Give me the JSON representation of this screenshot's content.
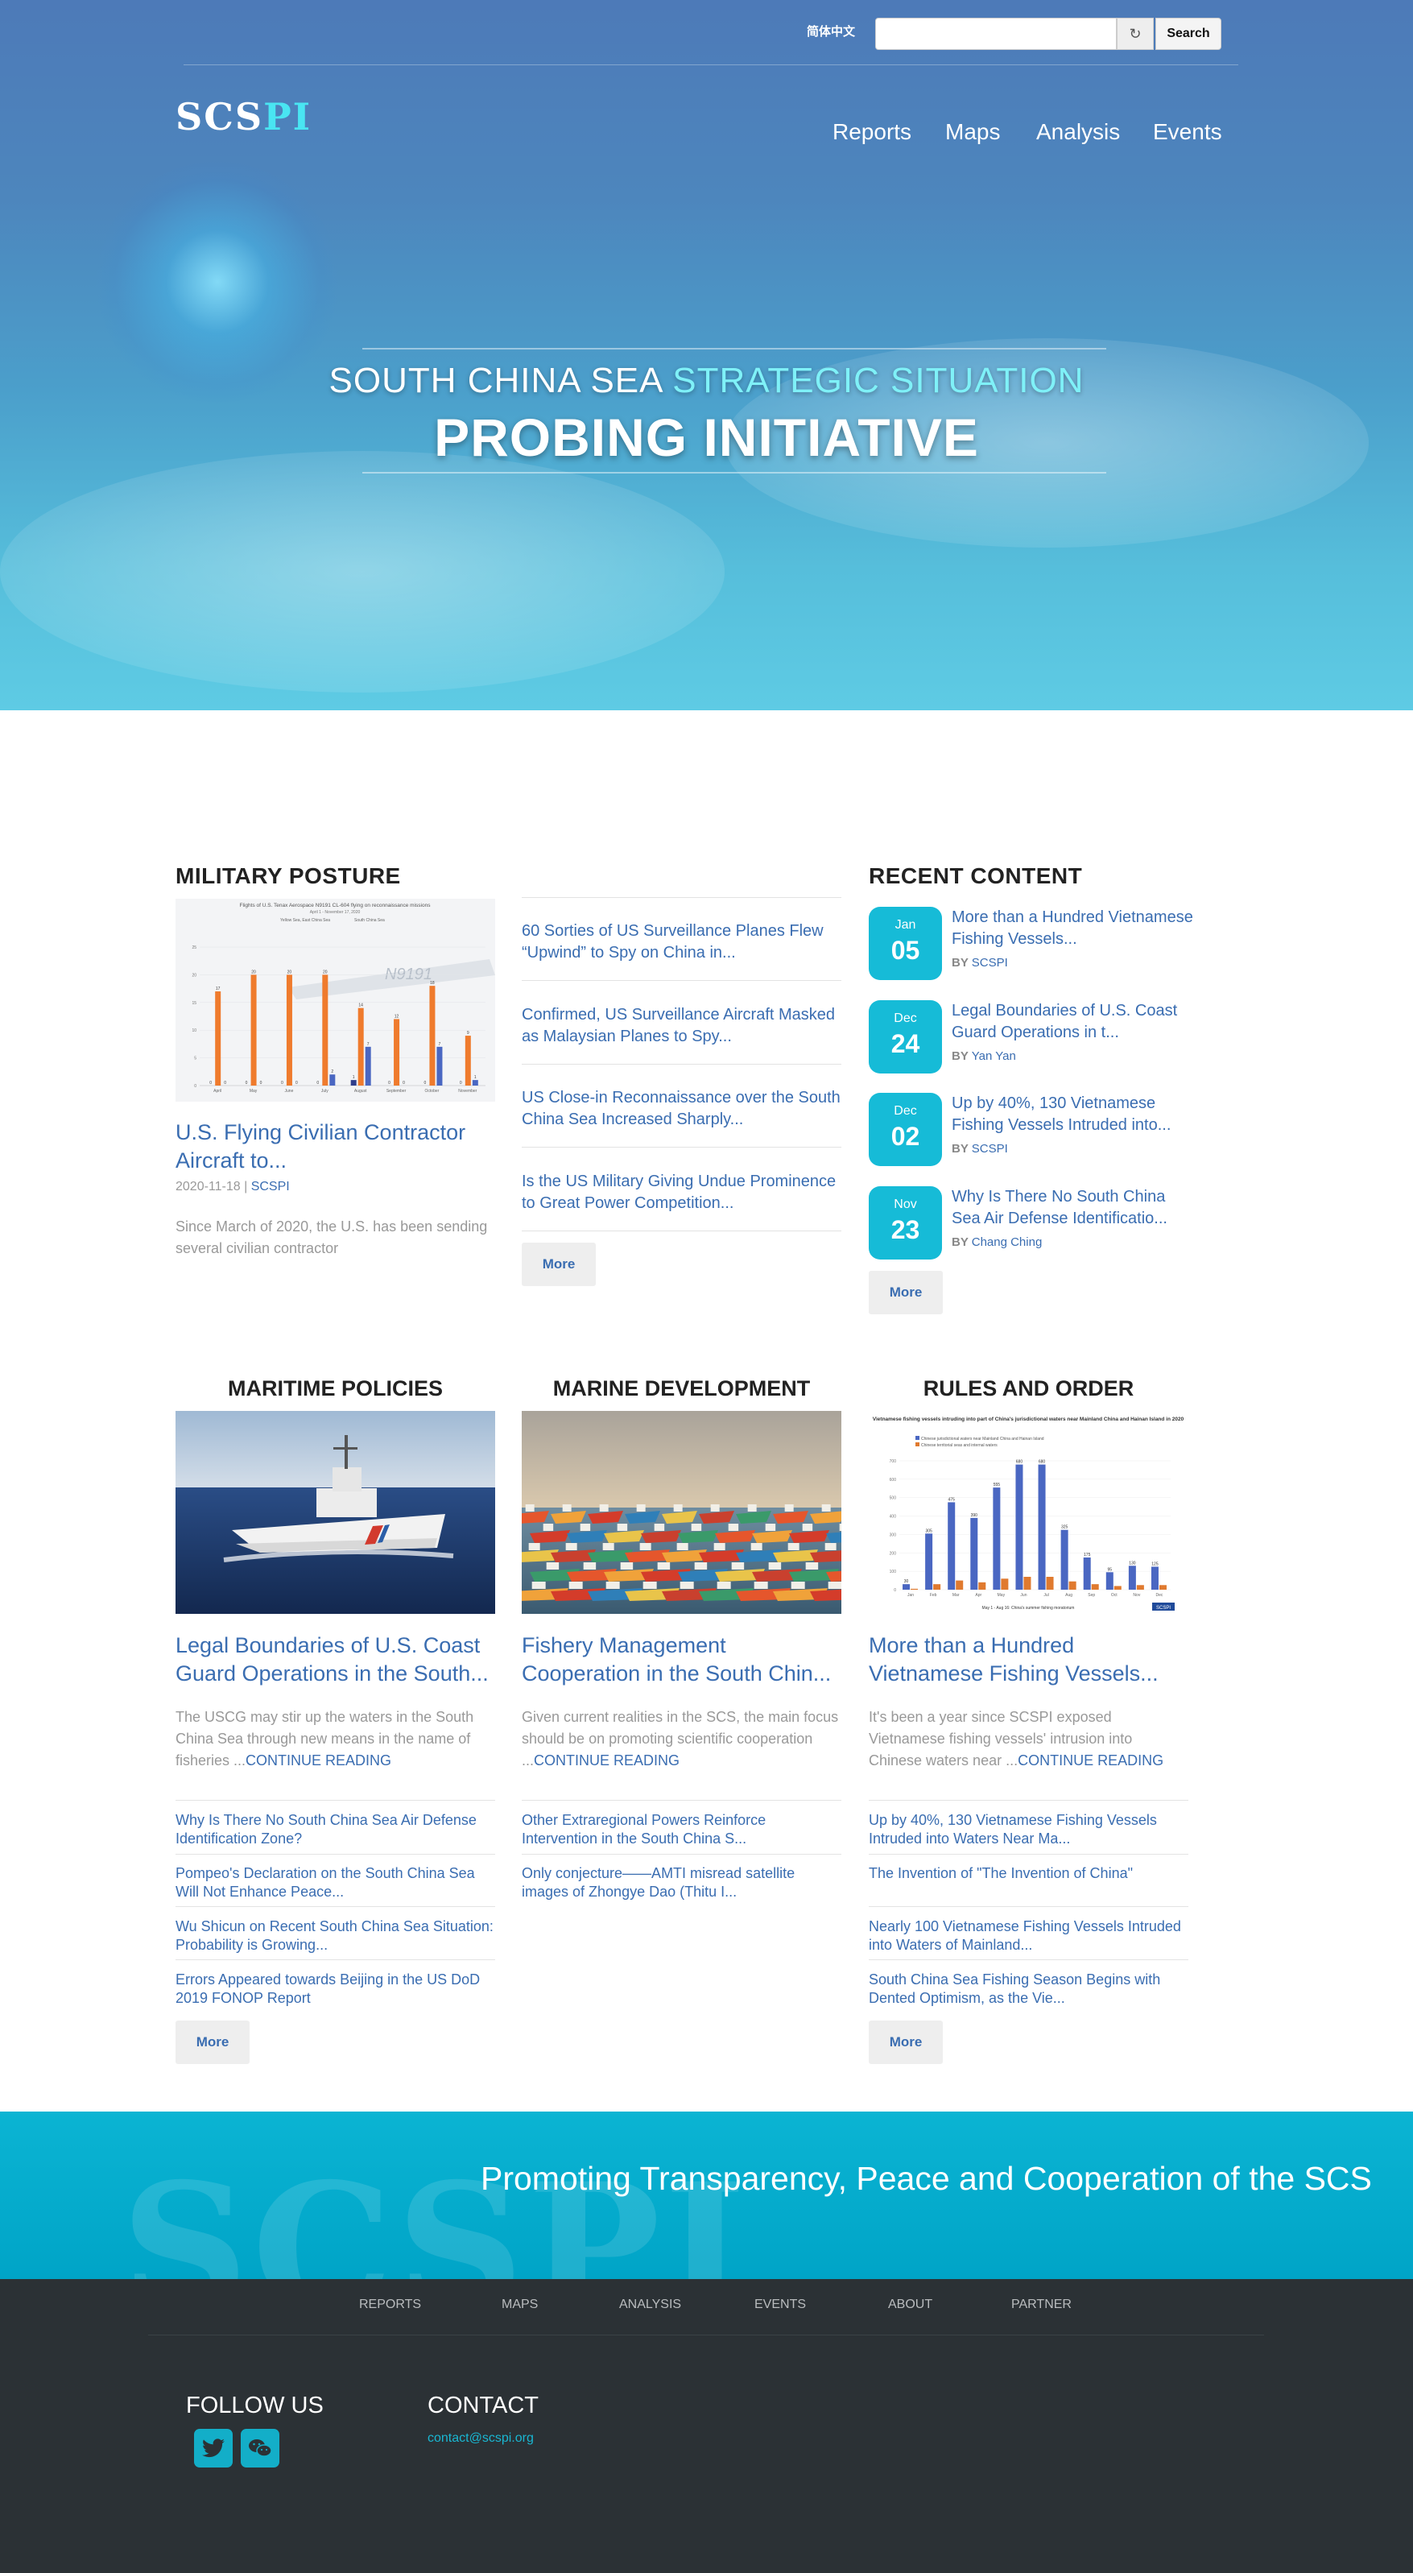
{
  "header": {
    "language_link": "简体中文",
    "search_placeholder": "",
    "search_button": "Search",
    "logo_main": "SCS",
    "logo_accent": "PI",
    "nav": [
      "Reports",
      "Maps",
      "Analysis",
      "Events"
    ]
  },
  "hero": {
    "line1_plain": "SOUTH CHINA SEA ",
    "line1_accent": "STRATEGIC SITUATION",
    "line2": "PROBING INITIATIVE"
  },
  "military": {
    "title": "MILITARY POSTURE",
    "chart_caption": "Flights of U.S. Tenax Aerospace N9191 CL-604 flying on reconnaissance missions",
    "chart_subcaption": "April 1 - November 17, 2020",
    "chart_legend": [
      "Yellow Sea, East China Sea",
      "South China Sea"
    ],
    "chart_months": [
      "April",
      "May",
      "June",
      "July",
      "August",
      "September",
      "October",
      "November"
    ],
    "aircraft_reg": "N9191",
    "headline": "U.S. Flying Civilian Contractor Aircraft to...",
    "date": "2020-11-18",
    "separator": " | ",
    "author": "SCSPI",
    "excerpt": "Since March of 2020, the U.S. has been sending several civilian contractor",
    "links": [
      "60 Sorties of US Surveillance Planes Flew “Upwind” to Spy on China in...",
      "Confirmed, US Surveillance Aircraft Masked as Malaysian Planes to Spy...",
      "US Close-in Reconnaissance over the South China Sea Increased Sharply...",
      "Is the US Military Giving Undue Prominence to Great Power Competition..."
    ],
    "more": "More"
  },
  "recent": {
    "title": "RECENT CONTENT",
    "by": "BY ",
    "items": [
      {
        "month": "Jan",
        "day": "05",
        "title": "More than a Hundred Vietnamese Fishing Vessels...",
        "author": "SCSPI"
      },
      {
        "month": "Dec",
        "day": "24",
        "title": "Legal Boundaries of U.S. Coast Guard Operations in t...",
        "author": "Yan Yan"
      },
      {
        "month": "Dec",
        "day": "02",
        "title": "Up by 40%, 130 Vietnamese Fishing Vessels Intruded into...",
        "author": "SCSPI"
      },
      {
        "month": "Nov",
        "day": "23",
        "title": "Why Is There No South China Sea Air Defense Identificatio...",
        "author": "Chang Ching"
      }
    ],
    "more": "More"
  },
  "maritime": {
    "title": "MARITIME POLICIES",
    "headline": "Legal Boundaries of U.S. Coast Guard Operations in the South...",
    "excerpt": "The USCG may stir up the waters in the South China Sea through new means in the name of fisheries ...",
    "continue": "CONTINUE READING",
    "links": [
      "Why Is There No South China Sea Air Defense Identification Zone?",
      "Pompeo's Declaration on the South China Sea Will Not Enhance Peace...",
      "Wu Shicun on Recent South China Sea Situation: Probability is Growing...",
      "Errors Appeared towards Beijing in the US DoD 2019 FONOP Report"
    ],
    "more": "More"
  },
  "marine": {
    "title": "MARINE DEVELOPMENT",
    "headline": "Fishery Management Cooperation in the South Chin...",
    "excerpt": "Given current realities in the SCS, the main focus should be on promoting scientific cooperation ...",
    "continue": "CONTINUE READING",
    "links": [
      "Other Extraregional Powers Reinforce Intervention in the South China S...",
      "Only conjecture——AMTI misread satellite images of Zhongye Dao (Thitu I..."
    ]
  },
  "rules": {
    "title": "RULES AND ORDER",
    "chart_caption": "Vietnamese fishing vessels intruding into part of China's jurisdictional waters near Mainland China and Hainan Island in 2020",
    "chart_legend": [
      "Chinese jurisdictional waters near Mainland China and Hainan Island",
      "Chinese territorial seas and internal waters"
    ],
    "chart_months": [
      "Jan",
      "Feb",
      "Mar",
      "Apr",
      "May",
      "Jun",
      "Jul",
      "Aug",
      "Sep",
      "Oct",
      "Nov",
      "Dec"
    ],
    "chart_footnote": "May 1 - Aug 16: China's summer fishing moratorium",
    "chart_badge": "SCSPI",
    "headline": "More than a Hundred Vietnamese Fishing Vessels...",
    "excerpt": "It's been a year since SCSPI exposed Vietnamese fishing vessels' intrusion into Chinese waters near ...",
    "continue": "CONTINUE READING",
    "links": [
      "Up by 40%, 130 Vietnamese Fishing Vessels Intruded into Waters Near Ma...",
      "The Invention of \"The Invention of China\"",
      "Nearly 100 Vietnamese Fishing Vessels Intruded into Waters of Mainland...",
      "South China Sea Fishing Season Begins with Dented Optimism, as the Vie..."
    ],
    "more": "More"
  },
  "band": {
    "ghost": "SCSPI",
    "motto": "Promoting Transparency, Peace and Cooperation of the SCS"
  },
  "footer": {
    "nav": [
      "REPORTS",
      "MAPS",
      "ANALYSIS",
      "EVENTS",
      "ABOUT",
      "PARTNER"
    ],
    "follow": "FOLLOW US",
    "contact": "CONTACT",
    "email": "contact@scspi.org"
  },
  "chart_data": [
    {
      "type": "bar",
      "title": "Flights of U.S. Tenax Aerospace N9191 CL-604 flying on reconnaissance missions",
      "categories": [
        "April",
        "May",
        "June",
        "July",
        "August",
        "September",
        "October",
        "November"
      ],
      "series": [
        {
          "name": "Yellow Sea, East China Sea",
          "values": [
            0,
            0,
            0,
            0,
            1,
            0,
            0,
            0
          ]
        },
        {
          "name": "South China Sea",
          "values": [
            17,
            20,
            20,
            20,
            14,
            12,
            18,
            9
          ]
        },
        {
          "name": "",
          "values": [
            0,
            0,
            0,
            2,
            7,
            0,
            7,
            1
          ]
        }
      ],
      "ylim": [
        0,
        25
      ]
    },
    {
      "type": "bar",
      "title": "Vietnamese fishing vessels intruding into part of China's jurisdictional waters near Mainland China and Hainan Island in 2020",
      "categories": [
        "Jan",
        "Feb",
        "Mar",
        "Apr",
        "May",
        "Jun",
        "Jul",
        "Aug",
        "Sep",
        "Oct",
        "Nov",
        "Dec"
      ],
      "series": [
        {
          "name": "Chinese jurisdictional waters near Mainland China and Hainan Island",
          "values": [
            30,
            305,
            475,
            390,
            555,
            680,
            680,
            325,
            175,
            95,
            130,
            125
          ]
        },
        {
          "name": "Chinese territorial seas and internal waters",
          "values": [
            5,
            30,
            50,
            40,
            60,
            70,
            70,
            45,
            30,
            20,
            25,
            25
          ]
        }
      ],
      "ylim": [
        0,
        700
      ]
    }
  ]
}
